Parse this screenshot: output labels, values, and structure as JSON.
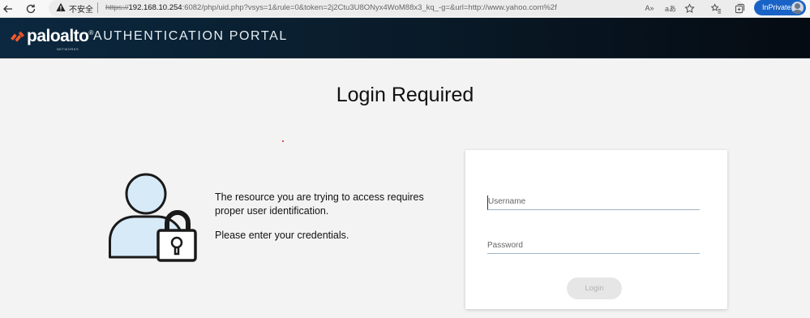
{
  "browser": {
    "insecure_label": "不安全",
    "url_scheme": "https://",
    "url_host": "192.168.10.254",
    "url_rest": ":6082/php/uid.php?vsys=1&rule=0&token=2j2Ctu3U8ONyx4WoM88x3_kq_-g=&url=http://www.yahoo.com%2f",
    "read_aloud_icon_text": "A»",
    "translate_icon_text": "aあ",
    "inprivate_label": "InPrivate"
  },
  "header": {
    "logo_text": "paloalto",
    "logo_reg": "®",
    "logo_sub": "NETWORKS",
    "title": "AUTHENTICATION PORTAL"
  },
  "main": {
    "title": "Login Required",
    "message_1": "The resource you are trying to access requires proper user identification.",
    "message_2": "Please enter your credentials."
  },
  "login": {
    "username_placeholder": "Username",
    "password_placeholder": "Password",
    "button_label": "Login"
  },
  "colors": {
    "header_dark": "#050b12",
    "brand_orange": "#fa582d",
    "inprivate_blue": "#1a63c6",
    "illustration_fill": "#d6eaf8"
  }
}
